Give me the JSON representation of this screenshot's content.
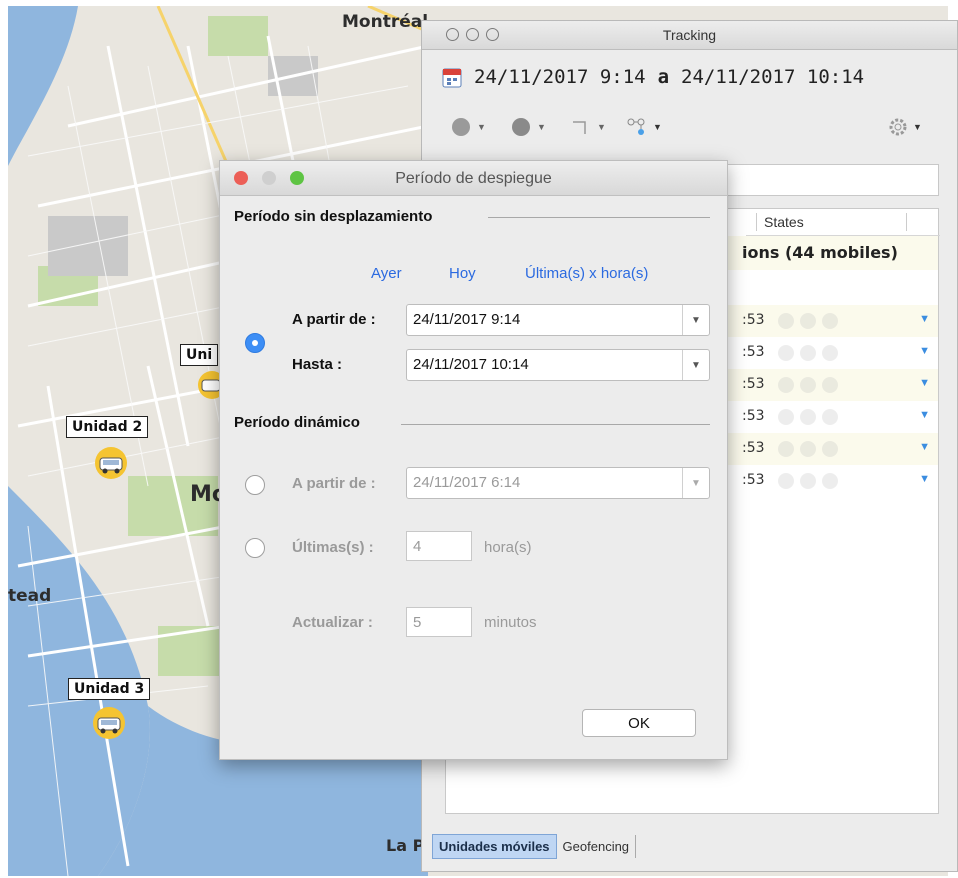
{
  "map": {
    "city_labels": [
      "Montréal",
      "Mo",
      "tead",
      "La P",
      "Uni"
    ],
    "units": [
      "Unidad 2",
      "Unidad 3"
    ]
  },
  "tracking": {
    "title": "Tracking",
    "date_from": "24/11/2017  9:14",
    "date_sep": "a",
    "date_to": "24/11/2017  10:14",
    "list": {
      "states_header": "States",
      "group_label": "ions (44 mobiles)",
      "row_times": [
        ":53",
        ":53",
        ":53",
        ":53",
        ":53",
        ":53"
      ]
    },
    "tabs": [
      "Unidades móviles",
      "Geofencing"
    ]
  },
  "dialog": {
    "title": "Período de despiegue",
    "section_fixed": "Período sin desplazamiento",
    "quick_links": [
      "Ayer",
      "Hoy",
      "Última(s) x hora(s)"
    ],
    "from_label": "A partir de :",
    "from_value": "24/11/2017 9:14",
    "to_label": "Hasta :",
    "to_value": "24/11/2017 10:14",
    "section_dynamic": "Período dinámico",
    "dyn_from_label": "A partir de :",
    "dyn_from_value": "24/11/2017 6:14",
    "last_label": "Últimas(s) :",
    "last_value": "4",
    "last_unit": "hora(s)",
    "refresh_label": "Actualizar :",
    "refresh_value": "5",
    "refresh_unit": "minutos",
    "ok_label": "OK"
  },
  "colors": {
    "accent": "#3d8ef5",
    "link": "#2b6ae0",
    "water": "#8fb6de",
    "park": "#c6dcaa",
    "close": "#ec5f57",
    "zoom": "#5ec443"
  }
}
